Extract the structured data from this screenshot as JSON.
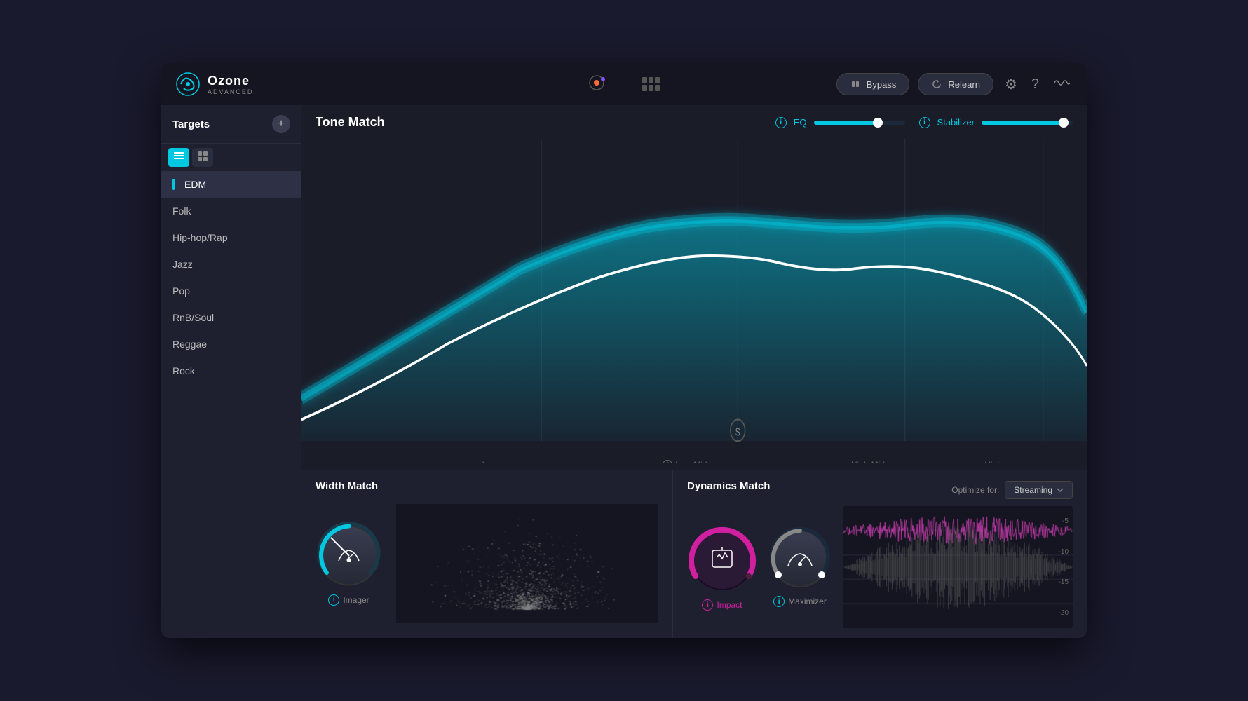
{
  "app": {
    "name": "Ozone",
    "subtitle": "ADVANCED"
  },
  "topbar": {
    "bypass_label": "Bypass",
    "relearn_label": "Relearn"
  },
  "sidebar": {
    "title": "Targets",
    "add_label": "+",
    "items": [
      {
        "label": "EDM",
        "active": true
      },
      {
        "label": "Folk",
        "active": false
      },
      {
        "label": "Hip-hop/Rap",
        "active": false
      },
      {
        "label": "Jazz",
        "active": false
      },
      {
        "label": "Pop",
        "active": false
      },
      {
        "label": "RnB/Soul",
        "active": false
      },
      {
        "label": "Reggae",
        "active": false
      },
      {
        "label": "Rock",
        "active": false
      }
    ]
  },
  "tone_match": {
    "title": "Tone Match",
    "eq_label": "EQ",
    "stabilizer_label": "Stabilizer",
    "eq_value": 70,
    "stabilizer_value": 90
  },
  "freq_labels": [
    {
      "label": "Low",
      "pos": "22%"
    },
    {
      "label": "Low-Mid",
      "pos": "48%"
    },
    {
      "label": "High-Mid",
      "pos": "72%"
    },
    {
      "label": "High",
      "pos": "90%"
    }
  ],
  "width_match": {
    "title": "Width Match",
    "knob_label": "Imager"
  },
  "dynamics_match": {
    "title": "Dynamics Match",
    "optimize_label": "Optimize for:",
    "optimize_value": "Streaming",
    "impact_label": "Impact",
    "maximizer_label": "Maximizer",
    "waveform_levels": [
      "-5",
      "-10",
      "-15",
      "-20"
    ]
  }
}
